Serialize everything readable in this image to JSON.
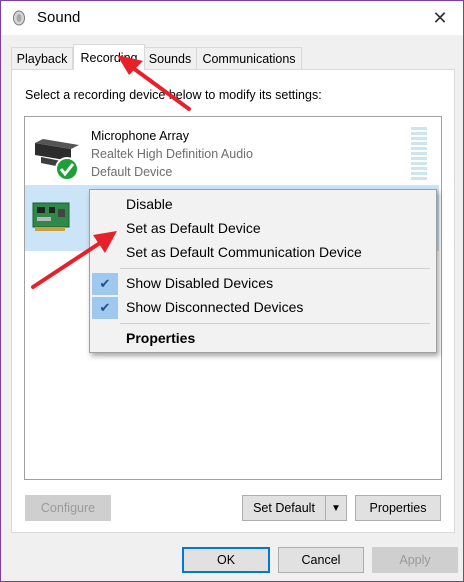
{
  "window": {
    "title": "Sound"
  },
  "tabs": [
    {
      "label": "Playback"
    },
    {
      "label": "Recording"
    },
    {
      "label": "Sounds"
    },
    {
      "label": "Communications"
    }
  ],
  "instructions": "Select a recording device below to modify its settings:",
  "devices": [
    {
      "name": "Microphone Array",
      "driver": "Realtek High Definition Audio",
      "status": "Default Device"
    }
  ],
  "context_menu": {
    "items": [
      {
        "label": "Disable"
      },
      {
        "label": "Set as Default Device"
      },
      {
        "label": "Set as Default Communication Device"
      },
      {
        "label": "Show Disabled Devices",
        "checked": true
      },
      {
        "label": "Show Disconnected Devices",
        "checked": true
      },
      {
        "label": "Properties",
        "bold": true
      }
    ]
  },
  "panel_buttons": {
    "configure": "Configure",
    "set_default": "Set Default",
    "properties": "Properties"
  },
  "dialog_buttons": {
    "ok": "OK",
    "cancel": "Cancel",
    "apply": "Apply"
  },
  "colors": {
    "accent": "#0078d7",
    "selection": "#cce4f7",
    "annotation_arrow": "#e8202a"
  }
}
